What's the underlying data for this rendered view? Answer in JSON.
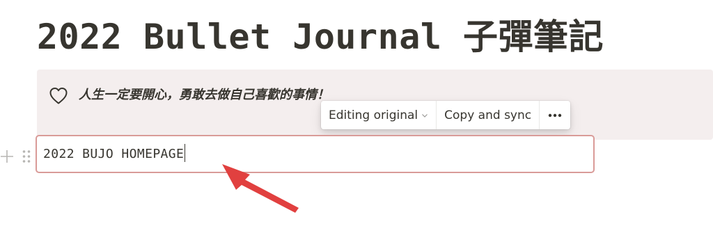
{
  "page": {
    "title": "2022 Bullet Journal 子彈筆記"
  },
  "callout": {
    "icon": "heart-outline-icon",
    "text": "人生一定要開心，勇敢去做自己喜歡的事情！",
    "background": "#f4eeee"
  },
  "sync_toolbar": {
    "editing_label": "Editing original",
    "copy_sync_label": "Copy and sync",
    "more_icon": "more-horizontal-icon"
  },
  "block": {
    "text": "2022 BUJO HOMEPAGE",
    "border_color": "#d99b98"
  },
  "annotation": {
    "arrow_color": "#e1403f"
  }
}
